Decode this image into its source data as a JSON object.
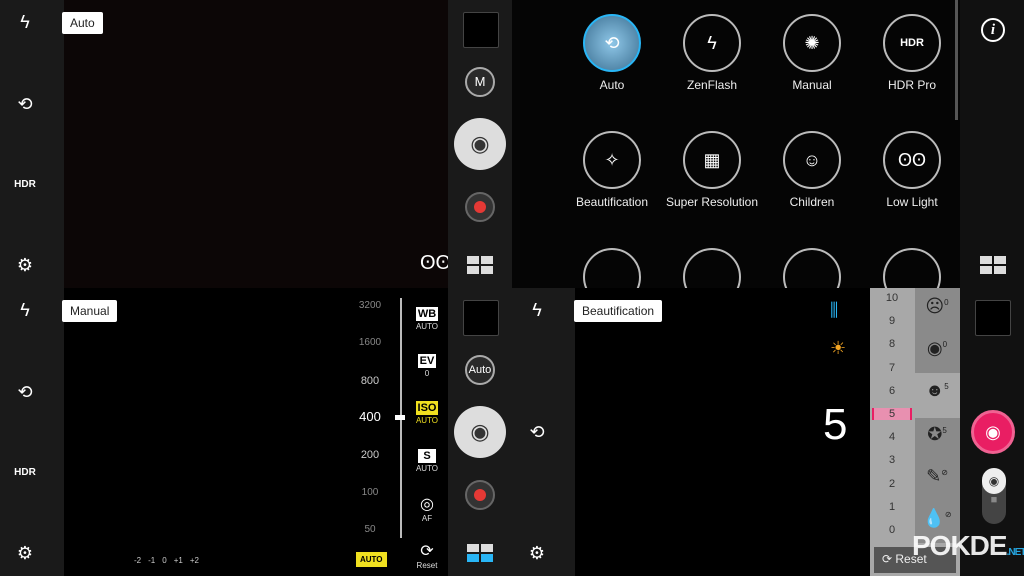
{
  "top_left": {
    "mode_tag": "Auto",
    "left_icons": [
      "flash-icon",
      "selfie-flip-icon",
      "hdr-icon",
      "settings-icon"
    ],
    "hdr_label": "HDR",
    "mode_button": "M",
    "low_light_indicator": "owl-icon"
  },
  "top_right": {
    "modes": [
      {
        "label": "Auto",
        "icon": "auto-photo-icon",
        "selected": true
      },
      {
        "label": "ZenFlash",
        "icon": "flash-unit-icon"
      },
      {
        "label": "Manual",
        "icon": "manual-dial-icon"
      },
      {
        "label": "HDR Pro",
        "icon": "hdr-pro-icon",
        "icon_text": "HDR"
      },
      {
        "label": "Beautification",
        "icon": "beautification-icon"
      },
      {
        "label": "Super Resolution",
        "icon": "super-resolution-icon"
      },
      {
        "label": "Children",
        "icon": "children-icon"
      },
      {
        "label": "Low Light",
        "icon": "low-light-owl-icon"
      }
    ],
    "info_icon": "i"
  },
  "bottom_left": {
    "mode_tag": "Manual",
    "hdr_label": "HDR",
    "iso_scale": [
      "3200",
      "1600",
      "800",
      "400",
      "200",
      "100",
      "50"
    ],
    "iso_selected": "400",
    "iso_auto_button": "AUTO",
    "settings": [
      {
        "label": "WB",
        "value": "AUTO"
      },
      {
        "label": "EV",
        "value": "0"
      },
      {
        "label": "ISO",
        "value": "AUTO",
        "active": true
      },
      {
        "label": "S",
        "value": "AUTO"
      },
      {
        "label": "AF",
        "icon": "focus-icon"
      },
      {
        "label": "Reset",
        "icon": "reset-icon"
      }
    ],
    "ev_scale": [
      "-2",
      "-1",
      "0",
      "+1",
      "+2"
    ],
    "mode_button": "Auto"
  },
  "bottom_right": {
    "mode_tag": "Beautification",
    "level_value": "5",
    "level_scale": [
      "10",
      "9",
      "8",
      "7",
      "6",
      "5",
      "4",
      "3",
      "2",
      "1",
      "0"
    ],
    "selected_level": "5",
    "features": [
      {
        "icon": "skin-softening-icon",
        "value": "0"
      },
      {
        "icon": "eye-enlarge-icon",
        "value": "0"
      },
      {
        "icon": "face-slim-icon",
        "value": "5"
      },
      {
        "icon": "skin-tone-icon",
        "value": "5"
      },
      {
        "icon": "lipstick-icon",
        "value": "⊘"
      },
      {
        "icon": "skin-brighten-icon",
        "value": "⊘"
      }
    ],
    "reset_label": "Reset",
    "accent": "#e91e63"
  },
  "colors": {
    "iso_active": "#f0e020",
    "beauty_accent": "#e91e63"
  },
  "watermark": "POKDE.NET"
}
